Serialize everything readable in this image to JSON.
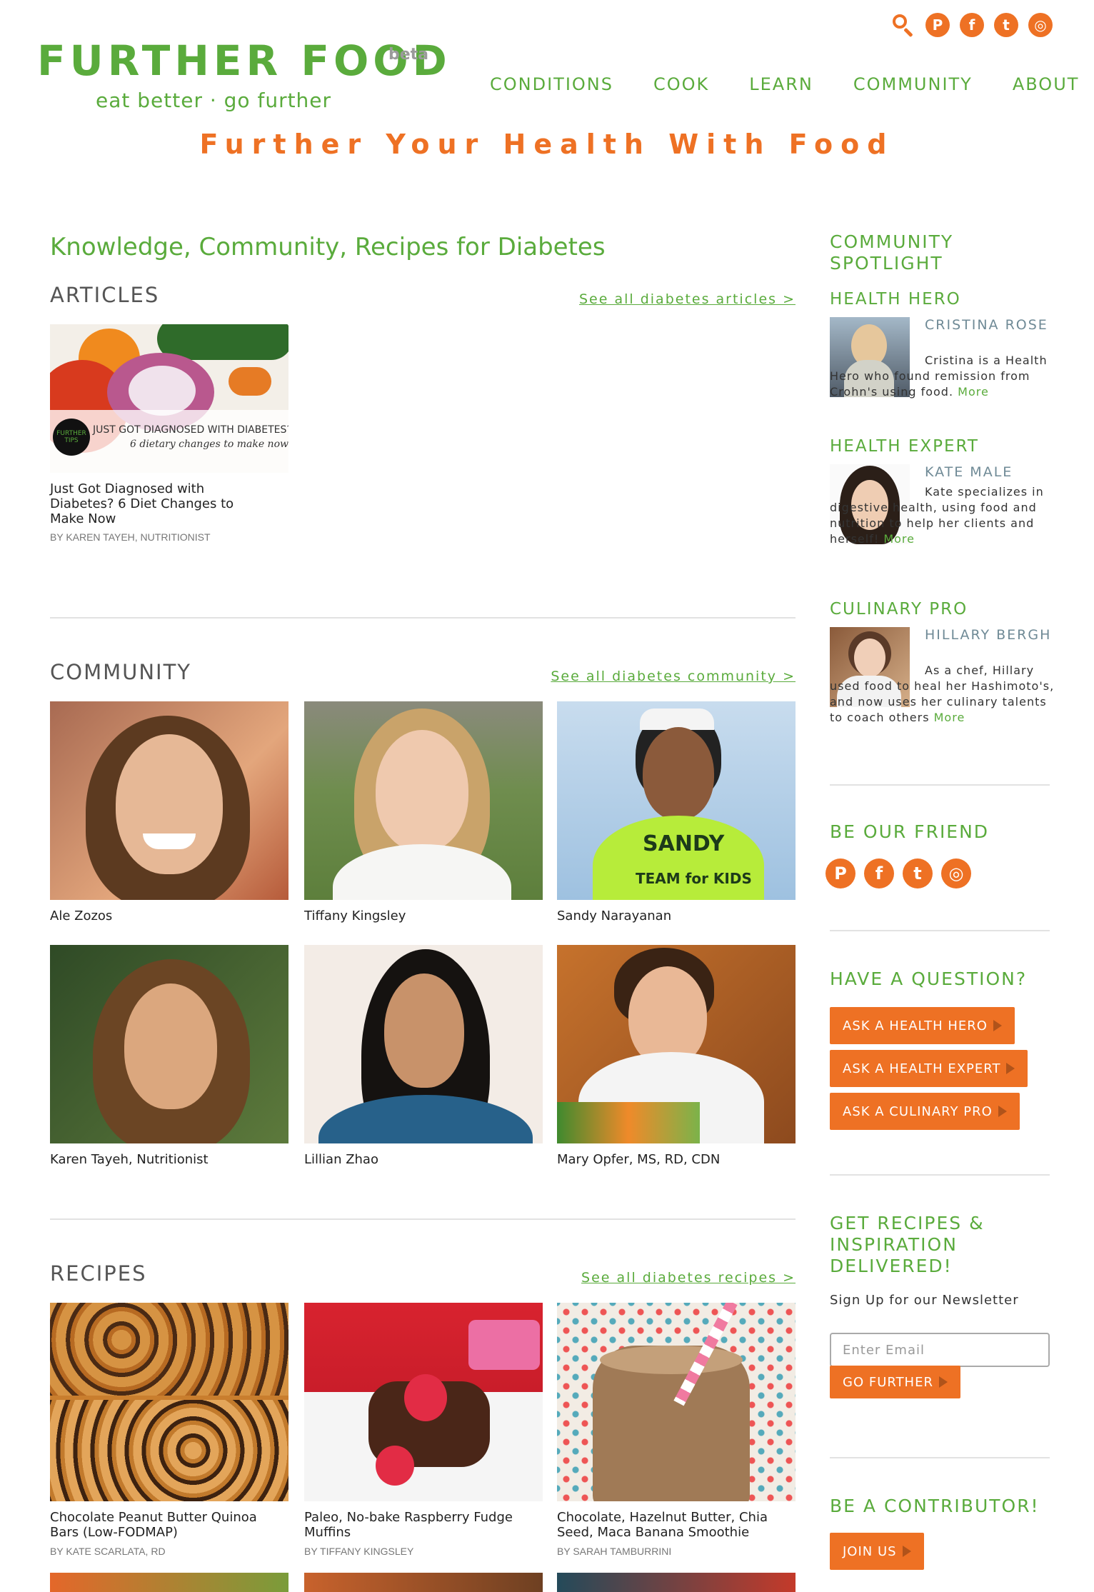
{
  "header": {
    "logo": "FURTHER FOOD",
    "beta": "beta",
    "tagline": "eat better · go further",
    "nav": [
      "CONDITIONS",
      "COOK",
      "LEARN",
      "COMMUNITY",
      "ABOUT"
    ],
    "social": {
      "pinterest": "P",
      "facebook": "f",
      "twitter": "t",
      "instagram": "◎"
    },
    "hero": "Further Your Health With Food"
  },
  "main": {
    "title": "Knowledge, Community, Recipes for Diabetes",
    "articles": {
      "title": "ARTICLES",
      "see_all": "See all diabetes articles >",
      "items": [
        {
          "caption": "Just Got Diagnosed with Diabetes? 6 Diet Changes to Make Now",
          "byline": "BY KAREN TAYEH, NUTRITIONIST",
          "overlay_title": "JUST GOT DIAGNOSED WITH DIABETES?",
          "overlay_sub": "6 dietary changes to make now",
          "badge": "FURTHER TIPS"
        }
      ]
    },
    "community": {
      "title": "COMMUNITY",
      "see_all": "See all diabetes community >",
      "members": [
        "Ale Zozos",
        "Tiffany Kingsley",
        "Sandy Narayanan",
        "Karen Tayeh, Nutritionist",
        "Lillian Zhao",
        "Mary Opfer, MS, RD, CDN"
      ],
      "shirt_text": "SANDY",
      "shirt_text2": "TEAM for KIDS"
    },
    "recipes": {
      "title": "RECIPES",
      "see_all": "See all diabetes recipes >",
      "items": [
        {
          "caption": "Chocolate Peanut Butter Quinoa Bars (Low-FODMAP)",
          "byline": "BY KATE SCARLATA, RD"
        },
        {
          "caption": "Paleo, No-bake Raspberry Fudge Muffins",
          "byline": "BY TIFFANY KINGSLEY"
        },
        {
          "caption": "Chocolate, Hazelnut Butter, Chia Seed, Maca Banana Smoothie",
          "byline": "BY SARAH TAMBURRINI"
        }
      ]
    }
  },
  "sidebar": {
    "spotlight_title": "COMMUNITY SPOTLIGHT",
    "hero": {
      "label": "HEALTH HERO",
      "name": "CRISTINA ROSE",
      "text": "Cristina is a Health Hero who found remission from Crohn's using food.",
      "more": "More"
    },
    "expert": {
      "label": "HEALTH EXPERT",
      "name": "KATE MALE",
      "text": "Kate specializes in digestive health, using food and nutrition to help her clients and herself!",
      "more": "More"
    },
    "pro": {
      "label": "CULINARY PRO",
      "name": "HILLARY BERGH",
      "text": "As a chef, Hillary used food to heal her Hashimoto's, and now uses her culinary talents to coach others",
      "more": "More"
    },
    "friend_title": "BE OUR FRIEND",
    "question_title": "HAVE A QUESTION?",
    "buttons": [
      "ASK A HEALTH HERO",
      "ASK A HEALTH EXPERT",
      "ASK A CULINARY PRO"
    ],
    "newsletter_title": "GET RECIPES & INSPIRATION DELIVERED!",
    "newsletter_sub": "Sign Up for our Newsletter",
    "email_placeholder": "Enter Email",
    "go_further": "GO FURTHER",
    "contributor_title": "BE A CONTRIBUTOR!",
    "join": "JOIN US"
  },
  "colors": {
    "brand_green": "#5aab3c",
    "accent_orange": "#ee7124"
  }
}
